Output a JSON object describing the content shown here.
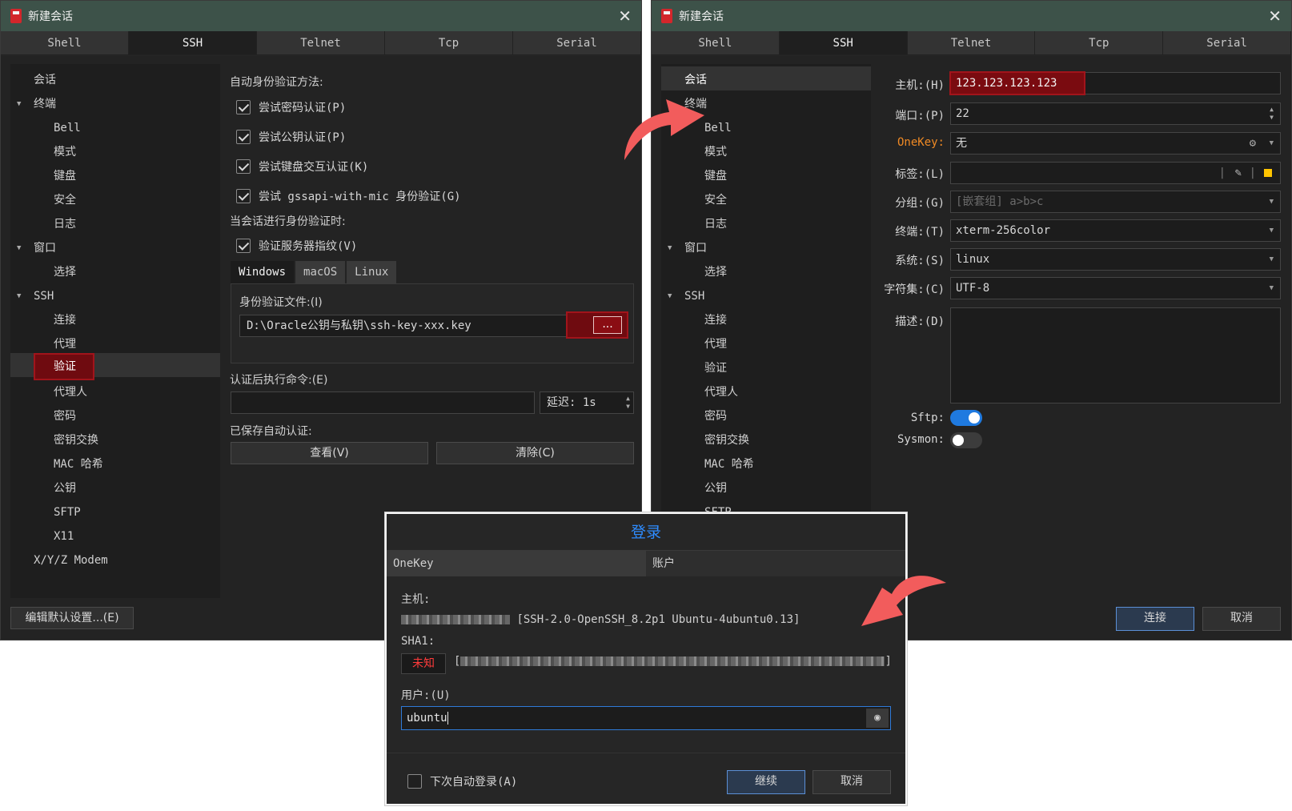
{
  "left_window": {
    "title": "新建会话",
    "tabs": [
      "Shell",
      "SSH",
      "Telnet",
      "Tcp",
      "Serial"
    ],
    "active_tab": "SSH",
    "tree": [
      "会话",
      "终端",
      "Bell",
      "模式",
      "键盘",
      "安全",
      "日志",
      "窗口",
      "选择",
      "SSH",
      "连接",
      "代理",
      "验证",
      "代理人",
      "密码",
      "密钥交换",
      "MAC 哈希",
      "公钥",
      "SFTP",
      "X11",
      "X/Y/Z Modem"
    ],
    "selected_item": "验证",
    "auth_methods_label": "自动身份验证方法:",
    "checkboxes": [
      {
        "label": "尝试密码认证(P)",
        "checked": true
      },
      {
        "label": "尝试公钥认证(P)",
        "checked": true
      },
      {
        "label": "尝试键盘交互认证(K)",
        "checked": true
      },
      {
        "label": "尝试 gssapi-with-mic 身份验证(G)",
        "checked": true
      }
    ],
    "during_auth_label": "当会话进行身份验证时:",
    "verify_fingerprint": {
      "label": "验证服务器指纹(V)",
      "checked": true
    },
    "os_tabs": [
      "Windows",
      "macOS",
      "Linux"
    ],
    "auth_file_label": "身份验证文件:(I)",
    "auth_file_value": "D:\\Oracle公钥与私钥\\ssh-key-xxx.key",
    "browse_label": "...",
    "post_auth_label": "认证后执行命令:(E)",
    "delay_value": "延迟: 1s",
    "saved_auth_label": "已保存自动认证:",
    "view_button": "查看(V)",
    "clear_button": "清除(C)",
    "edit_defaults_button": "编辑默认设置...(E)"
  },
  "right_window": {
    "title": "新建会话",
    "tabs": [
      "Shell",
      "SSH",
      "Telnet",
      "Tcp",
      "Serial"
    ],
    "active_tab": "SSH",
    "tree": [
      "会话",
      "终端",
      "Bell",
      "模式",
      "键盘",
      "安全",
      "日志",
      "窗口",
      "选择",
      "SSH",
      "连接",
      "代理",
      "验证",
      "代理人",
      "密码",
      "密钥交换",
      "MAC 哈希",
      "公钥",
      "SFTP"
    ],
    "selected_item": "会话",
    "host_label": "主机:(H)",
    "host_value": "123.123.123.123",
    "port_label": "端口:(P)",
    "port_value": "22",
    "onekey_label": "OneKey:",
    "onekey_value": "无",
    "tag_label": "标签:(L)",
    "group_label": "分组:(G)",
    "group_placeholder": "[嵌套组] a>b>c",
    "terminal_label": "终端:(T)",
    "terminal_value": "xterm-256color",
    "system_label": "系统:(S)",
    "system_value": "linux",
    "charset_label": "字符集:(C)",
    "charset_value": "UTF-8",
    "desc_label": "描述:(D)",
    "sftp_label": "Sftp:",
    "sftp_on": true,
    "sysmon_label": "Sysmon:",
    "sysmon_on": false,
    "connect_button": "连接",
    "cancel_button": "取消"
  },
  "login_dialog": {
    "title": "登录",
    "tabs": [
      "OneKey",
      "账户"
    ],
    "host_label": "主机:",
    "host_banner": "[SSH-2.0-OpenSSH_8.2p1 Ubuntu-4ubuntu0.13]",
    "sha1_label": "SHA1:",
    "unknown_badge": "未知",
    "user_label": "用户:(U)",
    "user_value": "ubuntu",
    "auto_login_label": "下次自动登录(A)",
    "continue_button": "继续",
    "cancel_button": "取消"
  },
  "colors": {
    "titlebar": "#3d5249",
    "highlight_red": "#a1141b",
    "toggle_on": "#1f7ae0",
    "arrow": "#f25c5c",
    "dialog_title": "#2f8cff"
  },
  "icons": [
    "close-icon",
    "app-icon",
    "caret-down-icon",
    "check-icon",
    "spinner-icon",
    "gear-icon",
    "edit-icon",
    "color-square-icon",
    "eye-icon",
    "curved-arrow-icon"
  ]
}
